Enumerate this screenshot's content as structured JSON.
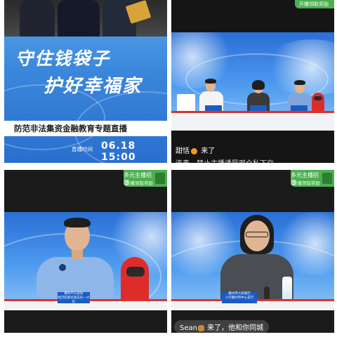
{
  "poster": {
    "title_line1": "守住钱袋子",
    "title_line2": "护好幸福家",
    "subtitle": "防范非法集资金融教育专题直播",
    "time_label": "直播时间",
    "time_value": "06.18 15:00"
  },
  "stream_top_right": {
    "badge_line1": "开播领取奖励",
    "chat_user": "甜恬",
    "chat_action": "来了",
    "chat_notice": "连麦、禁止主播诱导观众私下交"
  },
  "stream_bottom_left": {
    "badge_line1": "多元主播招募",
    "badge_line2": "开播领取奖励",
    "namecard_line1": "赣州市公安局",
    "namecard_line2": "经济犯罪侦查支队一大队"
  },
  "stream_bottom_right": {
    "badge_line1": "多元主播招募",
    "badge_line2": "开播领取奖励",
    "namecard_line1": "赣州市人民银行",
    "namecard_line2": "人行赣州市中心支行",
    "chat_user": "Sean",
    "chat_action": "来了，他和你同城"
  },
  "colors": {
    "poster_blue": "#3a86db",
    "badge_green": "#4caf50",
    "studio_blue": "#2a6fd6"
  }
}
